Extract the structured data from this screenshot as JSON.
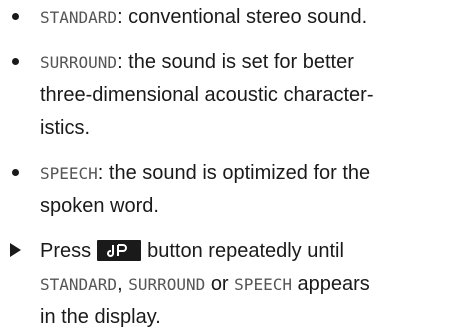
{
  "items": [
    {
      "type": "bullet",
      "term": "STANDARD",
      "lines": [
        ": conventional stereo sound."
      ]
    },
    {
      "type": "bullet",
      "term": "SURROUND",
      "lines": [
        ": the sound is set for better",
        "three-dimensional acoustic character-",
        "istics."
      ]
    },
    {
      "type": "bullet",
      "term": "SPEECH",
      "lines": [
        ": the sound is optimized for the",
        "spoken word."
      ]
    }
  ],
  "step": {
    "press": "Press",
    "after_button": "button repeatedly until",
    "opt1": "STANDARD",
    "comma1": ",",
    "opt2": "SURROUND",
    "or": "or",
    "opt3": "SPEECH",
    "appears": "appears",
    "last_line": "in the display.",
    "button_icon": "sound-mode-icon"
  }
}
